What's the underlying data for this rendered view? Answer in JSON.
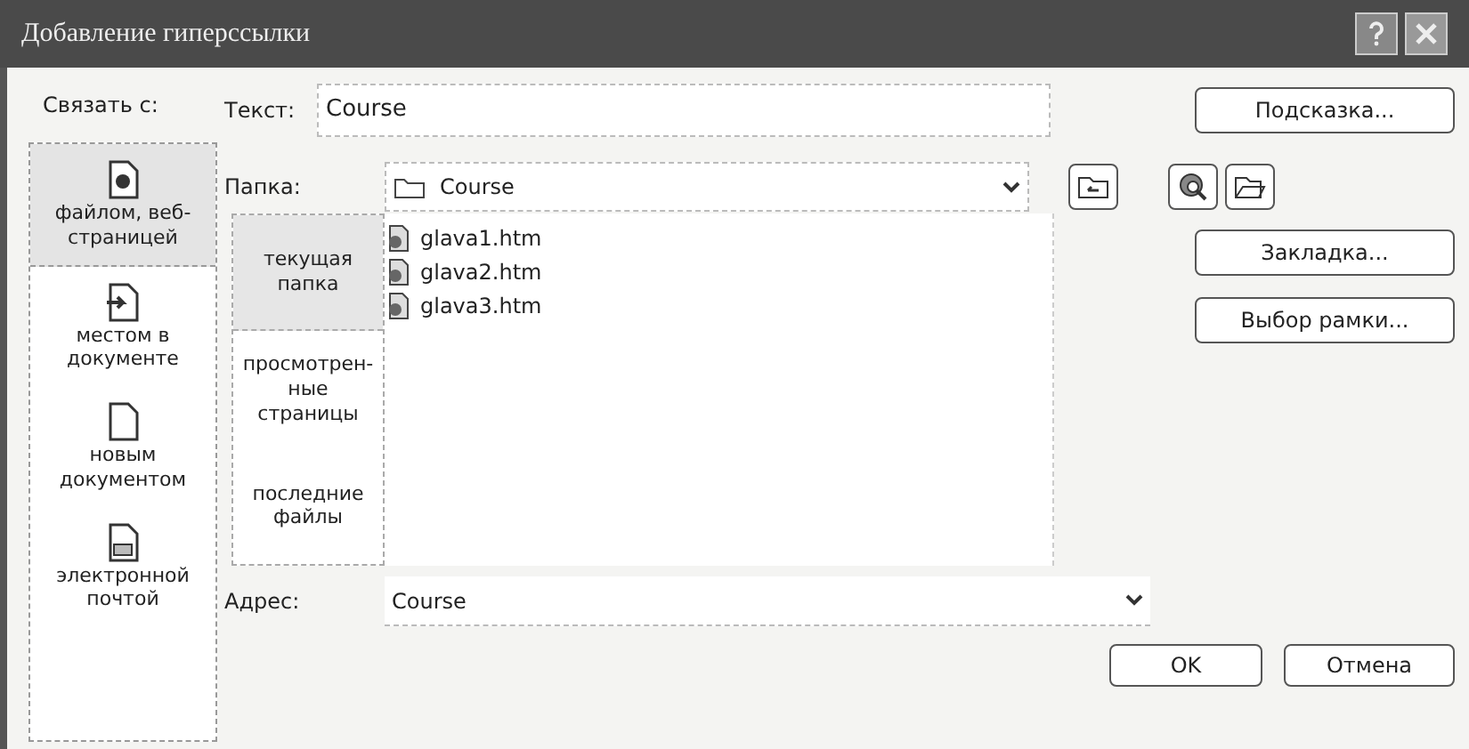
{
  "window": {
    "title": "Добавление гиперссылки"
  },
  "link_to": {
    "label": "Связать с:",
    "items": [
      {
        "label": "файлом, веб-страницей",
        "selected": true
      },
      {
        "label": "местом в документе",
        "selected": false
      },
      {
        "label": "новым документом",
        "selected": false
      },
      {
        "label": "электронной почтой",
        "selected": false
      }
    ]
  },
  "text_field": {
    "label": "Текст:",
    "value": "Course"
  },
  "folder": {
    "label": "Папка:",
    "value": "Course"
  },
  "views": [
    {
      "label": "текущая папка",
      "selected": true
    },
    {
      "label": "просмотрен-ные страницы",
      "selected": false
    },
    {
      "label": "последние файлы",
      "selected": false
    }
  ],
  "files": [
    "glava1.htm",
    "glava2.htm",
    "glava3.htm"
  ],
  "address": {
    "label": "Адрес:",
    "value": "Course"
  },
  "side_buttons": [
    "Подсказка...",
    "Закладка...",
    "Выбор рамки..."
  ],
  "buttons": [
    "OK",
    "Отмена"
  ]
}
